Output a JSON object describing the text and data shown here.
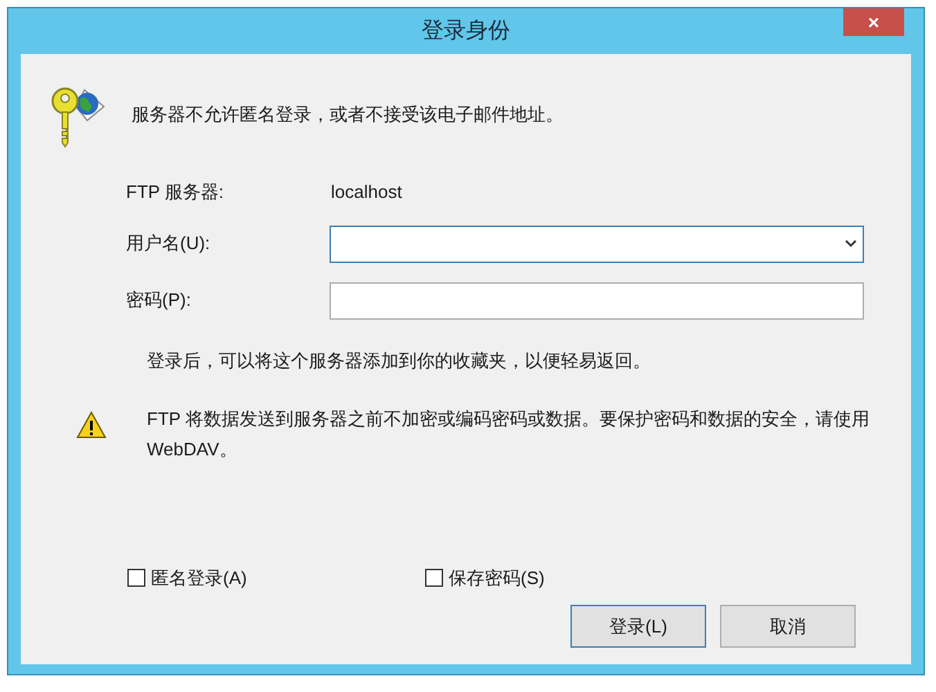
{
  "window": {
    "title": "登录身份",
    "close": "×"
  },
  "message": "服务器不允许匿名登录，或者不接受该电子邮件地址。",
  "server": {
    "label": "FTP 服务器:",
    "value": "localhost"
  },
  "username": {
    "label": "用户名(U):"
  },
  "password": {
    "label": "密码(P):"
  },
  "note": "登录后，可以将这个服务器添加到你的收藏夹，以便轻易返回。",
  "warning": "FTP 将数据发送到服务器之前不加密或编码密码或数据。要保护密码和数据的安全，请使用 WebDAV。",
  "checkboxes": [
    {
      "label": "匿名登录(A)",
      "checked": false
    },
    {
      "label": "保存密码(S)",
      "checked": false
    }
  ],
  "buttons": [
    {
      "label": "登录(L)",
      "selected": true
    },
    {
      "label": "取消",
      "selected": false
    }
  ]
}
